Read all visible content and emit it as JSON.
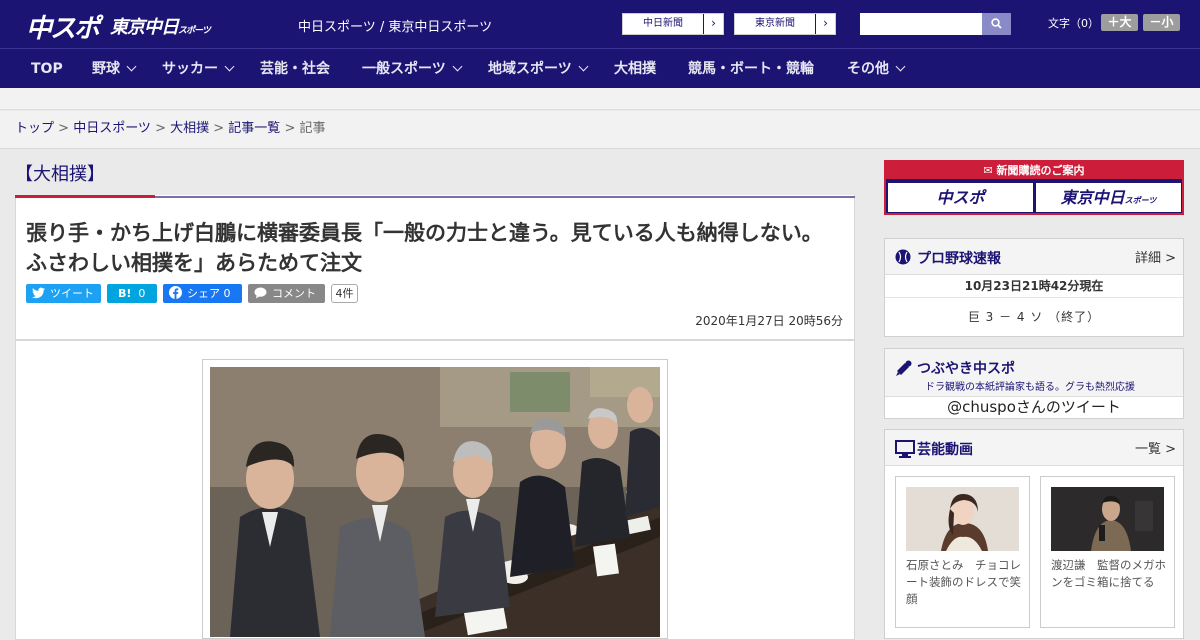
{
  "header": {
    "logo_main": "中スポ",
    "logo_tokyo": "東京中日",
    "logo_tokyo_small": "スポーツ",
    "site_name": "中日スポーツ / 東京中日スポーツ",
    "papers": [
      {
        "label": "中日新聞"
      },
      {
        "label": "東京新聞"
      }
    ],
    "search": {
      "placeholder": ""
    },
    "font_size_label": "文字（0）",
    "font_larger": "＋大",
    "font_smaller": "－小"
  },
  "nav": {
    "items": [
      {
        "label": "TOP"
      },
      {
        "label": "野球"
      },
      {
        "label": "サッカー"
      },
      {
        "label": "芸能・社会"
      },
      {
        "label": "一般スポーツ"
      },
      {
        "label": "地域スポーツ"
      },
      {
        "label": "大相撲"
      },
      {
        "label": "競馬・ボート・競輪"
      },
      {
        "label": "その他"
      }
    ]
  },
  "breadcrumb": {
    "items": [
      "トップ",
      "中日スポーツ",
      "大相撲",
      "記事一覧"
    ],
    "current": "記事",
    "separator": " > "
  },
  "article": {
    "category": "【大相撲】",
    "headline": "張り手・かち上げ白鵬に横審委員長「一般の力士と違う。見ている人も納得しない。ふさわしい相撲を」あらためて注文",
    "share": {
      "tweet": "ツイート",
      "hatena": "B!",
      "hatena_count": "0",
      "facebook": "シェア",
      "facebook_count": "0",
      "comment": "コメント",
      "comment_count": "4件"
    },
    "date": "2020年1月27日 20時56分"
  },
  "sidebar": {
    "subscription": {
      "title": "新聞購読のご案内",
      "card1": "中スポ",
      "card2": "東京中日",
      "card2_small": "スポーツ"
    },
    "baseball": {
      "title": "プロ野球速報",
      "more": "詳細 >",
      "time": "10月23日21時42分現在",
      "score": "巨 3 － 4 ソ （終了）"
    },
    "tweets": {
      "title": "つぶやき中スポ",
      "subtitle": "ドラ観戦の本紙評論家も語る。グラも熱烈応援",
      "handle": "@chuspoさんのツイート"
    },
    "videos": {
      "title": "芸能動画",
      "more": "一覧 >",
      "items": [
        {
          "caption": "石原さとみ　チョコレート装飾のドレスで笑顔"
        },
        {
          "caption": "渡辺謙　監督のメガホンをゴミ箱に捨てる"
        }
      ]
    }
  },
  "colors": {
    "brand_navy": "#1c1473",
    "accent_red": "#cc1e3a",
    "twitter": "#1da1f2",
    "hatena": "#00a4de",
    "facebook": "#1877f2",
    "comment": "#888888"
  }
}
